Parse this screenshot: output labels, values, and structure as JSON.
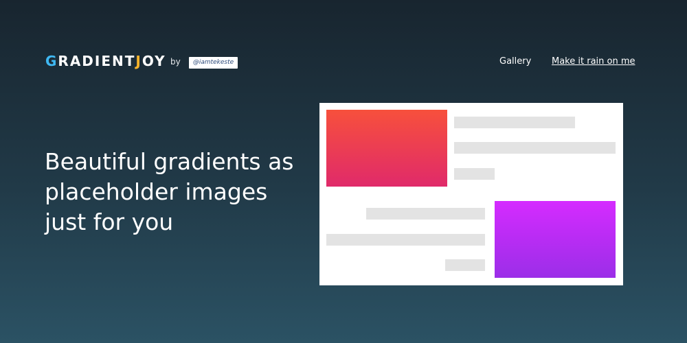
{
  "logo": {
    "g": "G",
    "rest": "RADIENT",
    "j": "J",
    "end": "OY"
  },
  "byline": "by",
  "handle": "@iamtekeste",
  "nav": {
    "gallery": "Gallery",
    "rain": "Make it rain on me"
  },
  "hero": {
    "line1": "Beautiful gradients as",
    "line2": "placeholder images",
    "line3": "just for you"
  },
  "colors": {
    "logo_g": "#3fb8f2",
    "logo_j": "#f6b32b",
    "gradient_a": [
      "#f7503c",
      "#e02a6a"
    ],
    "gradient_b": [
      "#d52bff",
      "#9b2ee8"
    ]
  }
}
